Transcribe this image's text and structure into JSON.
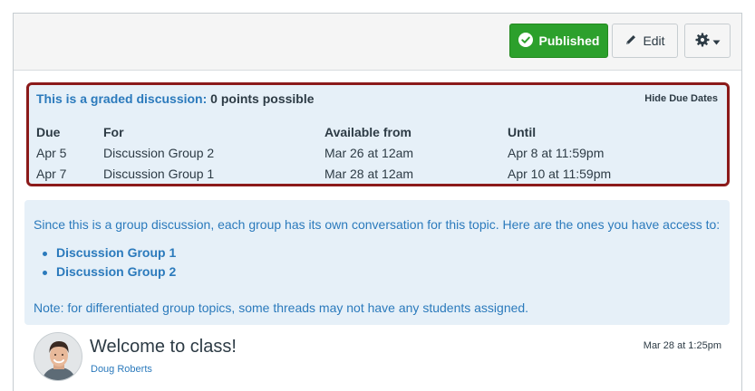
{
  "toolbar": {
    "published_label": "Published",
    "edit_label": "Edit"
  },
  "due_dates": {
    "graded_text": "This is a graded discussion:",
    "points_text": "0 points possible",
    "hide_label": "Hide Due Dates",
    "headers": {
      "due": "Due",
      "for": "For",
      "available": "Available from",
      "until": "Until"
    },
    "rows": [
      {
        "due": "Apr 5",
        "for": "Discussion Group 2",
        "available": "Mar 26 at 12am",
        "until": "Apr 8 at 11:59pm"
      },
      {
        "due": "Apr 7",
        "for": "Discussion Group 1",
        "available": "Mar 28 at 12am",
        "until": "Apr 10 at 11:59pm"
      }
    ]
  },
  "groups": {
    "intro": "Since this is a group discussion, each group has its own conversation for this topic. Here are the ones you have access to:",
    "items": [
      {
        "label": "Discussion Group 1"
      },
      {
        "label": "Discussion Group 2"
      }
    ],
    "note": "Note: for differentiated group topics, some threads may not have any students assigned."
  },
  "entry": {
    "title": "Welcome to class!",
    "author": "Doug Roberts",
    "date": "Mar 28 at 1:25pm"
  },
  "colors": {
    "accent": "#2b7abc",
    "published": "#2ca02c",
    "highlight_border": "#8b1a1a",
    "panel_bg": "#e6f0f8"
  },
  "icons": {
    "published": "check-circle-icon",
    "edit": "pencil-icon",
    "settings": "gear-icon",
    "settings_caret": "caret-down-icon"
  }
}
